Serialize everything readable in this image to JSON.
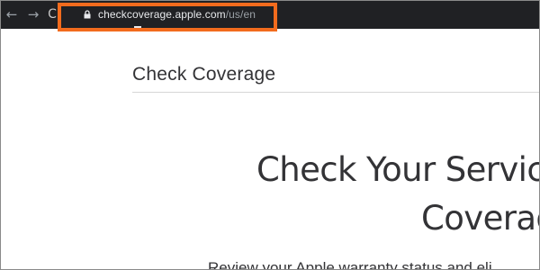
{
  "browser": {
    "back_icon": "←",
    "forward_icon": "→",
    "reload_icon": "C",
    "url_host": "checkcoverage.apple.com",
    "url_path": "/us/en"
  },
  "annotation": {
    "highlight_color": "#f26b1d"
  },
  "page": {
    "section_title": "Check Coverage",
    "hero_line1": "Check Your Service",
    "hero_line2": "Coverag",
    "subtext": "Review your Apple warranty status and eli"
  },
  "colors": {
    "chrome_bg": "#202124",
    "text_dark": "#333336"
  }
}
